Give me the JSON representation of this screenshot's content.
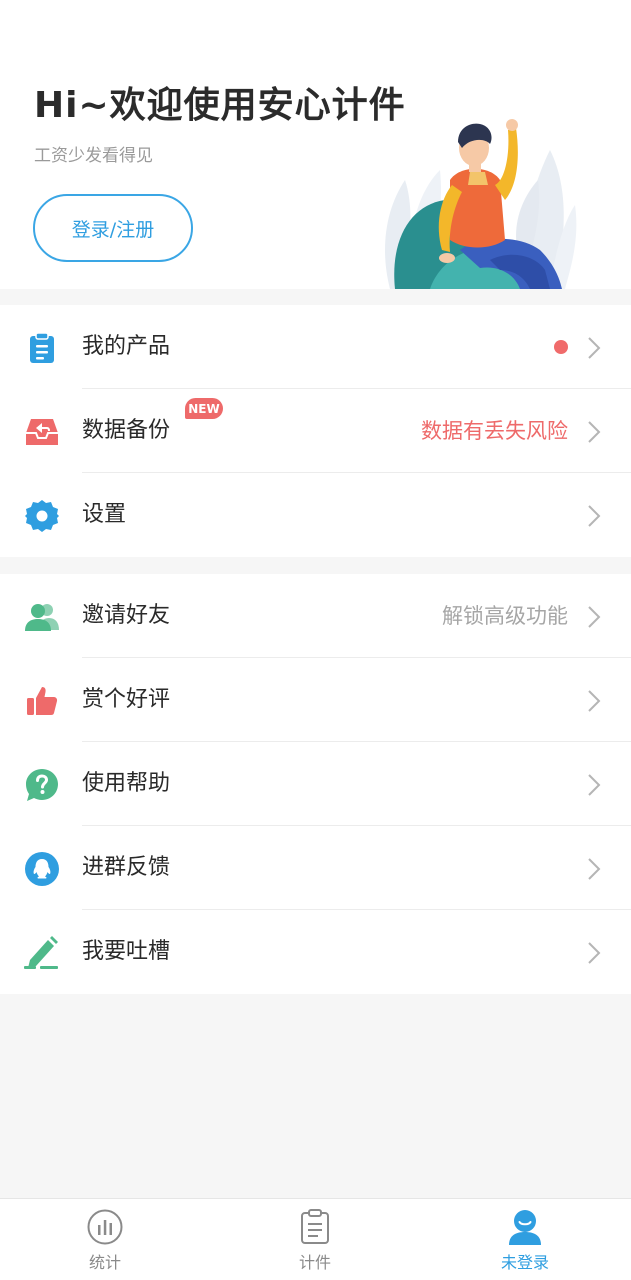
{
  "header": {
    "greeting": "Hi~欢迎使用安心计件",
    "subtitle": "工资少发看得见",
    "login_label": "登录/注册"
  },
  "menu_group_1": [
    {
      "icon": "clipboard-icon",
      "label": "我的产品",
      "right_text": "",
      "has_dot": true,
      "color": "#2f9ee0"
    },
    {
      "icon": "inbox-backup-icon",
      "label": "数据备份",
      "right_text": "数据有丢失风险",
      "badge": "NEW",
      "color": "#ee6a6a"
    },
    {
      "icon": "gear-icon",
      "label": "设置",
      "right_text": "",
      "color": "#2f9ee0"
    }
  ],
  "menu_group_2": [
    {
      "icon": "users-icon",
      "label": "邀请好友",
      "right_text": "解锁高级功能",
      "color": "#4fb98a"
    },
    {
      "icon": "thumbs-up-icon",
      "label": "赏个好评",
      "right_text": "",
      "color": "#ee6a6a"
    },
    {
      "icon": "question-bubble-icon",
      "label": "使用帮助",
      "right_text": "",
      "color": "#4fb98a"
    },
    {
      "icon": "qq-penguin-icon",
      "label": "进群反馈",
      "right_text": "",
      "color": "#2f9ee0"
    },
    {
      "icon": "pencil-edit-icon",
      "label": "我要吐槽",
      "right_text": "",
      "color": "#4fb98a"
    }
  ],
  "tabs": [
    {
      "label": "统计",
      "icon": "chart-circle-icon",
      "active": false
    },
    {
      "label": "计件",
      "icon": "clipboard-list-icon",
      "active": false
    },
    {
      "label": "未登录",
      "icon": "user-avatar-icon",
      "active": true
    }
  ],
  "colors": {
    "accent": "#2f9ee0",
    "warning": "#ee6a6a",
    "muted": "#a6a6a6"
  }
}
